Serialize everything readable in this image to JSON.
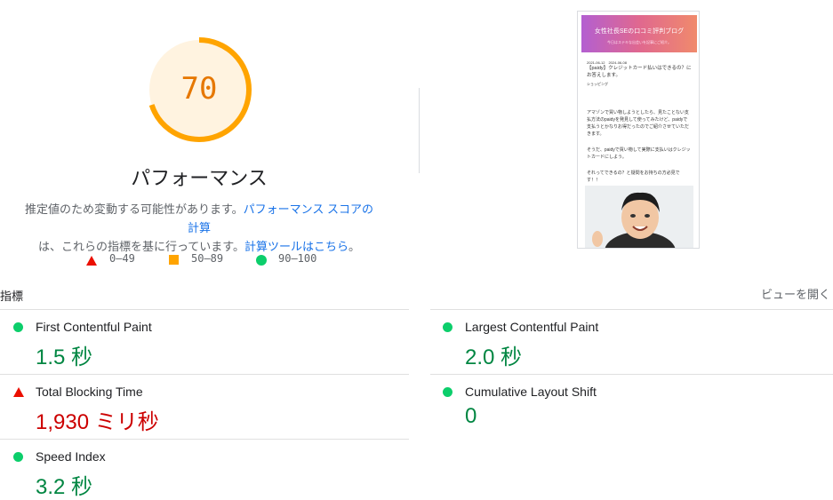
{
  "gauge": {
    "score": "70",
    "score_fraction": 0.7,
    "title": "パフォーマンス",
    "ring_color": "#ffa400",
    "ring_bg": "#fff3e0",
    "score_color": "#e67700"
  },
  "description": {
    "prefix": "推定値のため変動する可能性があります。",
    "link1": "パフォーマンス スコアの計算",
    "middle": "は、これらの指標を基に行っています。",
    "link2": "計算ツールはこちら",
    "suffix": "。"
  },
  "legend": [
    {
      "icon": "red-triangle-icon",
      "range": "0–49"
    },
    {
      "icon": "orange-square-icon",
      "range": "50–89"
    },
    {
      "icon": "green-circle-icon",
      "range": "90–100"
    }
  ],
  "screenshot": {
    "title": "女性社長SEの口コミ評判ブログ",
    "subtitle": "今日はステキな出会いを記事にご紹介。",
    "date": "2021-06-12　2024-06-08",
    "post_title": "【paidy】クレジットカード払いはできるの？にお答えします。",
    "category": "ショッピング",
    "para1": "アマゾンで買い物しようとしたら、見たことない支払方法のpaidyを発見して使ってみたけど、paidyで支払うとかなりお得だったのでご紹介させていただきます。",
    "para2": "そうだ、paidyで買い物して実際に支払いはクレジットカードにしよう。",
    "para3": "それってできるの？と疑問をお持ちの方必見です！！"
  },
  "metrics": {
    "label": "指標",
    "expand": "ビューを開く",
    "items": [
      {
        "name": "First Contentful Paint",
        "value": "1.5 秒",
        "status": "good"
      },
      {
        "name": "Largest Contentful Paint",
        "value": "2.0 秒",
        "status": "good"
      },
      {
        "name": "Total Blocking Time",
        "value": "1,930 ミリ秒",
        "status": "poor"
      },
      {
        "name": "Cumulative Layout Shift",
        "value": "0",
        "status": "good"
      },
      {
        "name": "Speed Index",
        "value": "3.2 秒",
        "status": "good"
      }
    ]
  }
}
